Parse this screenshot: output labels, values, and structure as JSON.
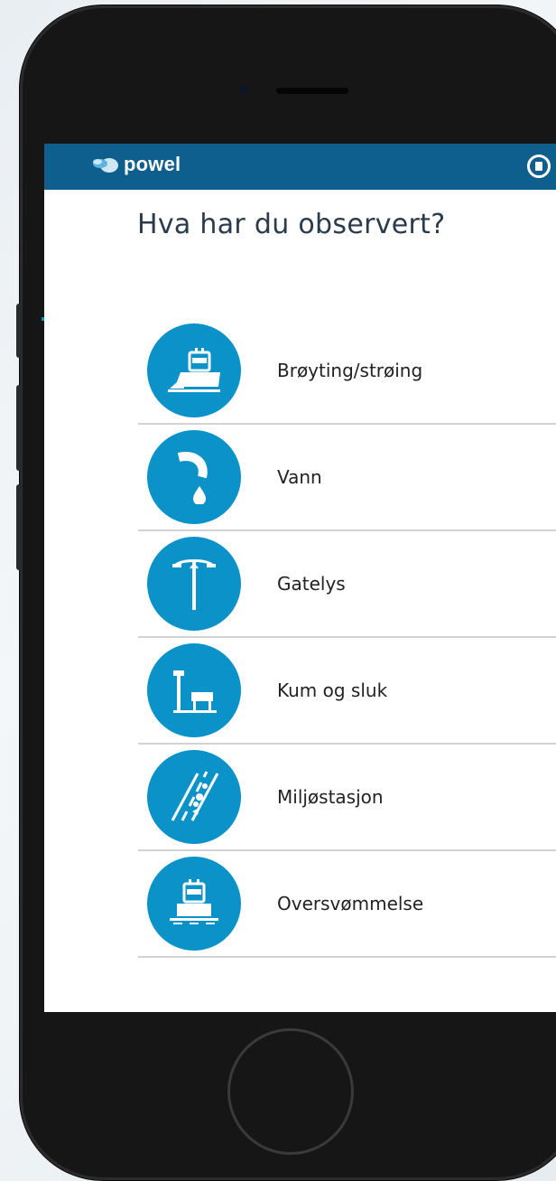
{
  "app": {
    "logo_text": "powel",
    "menu_icon": "menu-icon"
  },
  "page": {
    "title": "Hva har du observert?"
  },
  "categories": [
    {
      "label": "Brøyting/strøing",
      "icon": "snowplow-icon"
    },
    {
      "label": "Vann",
      "icon": "water-tap-icon"
    },
    {
      "label": "Gatelys",
      "icon": "streetlight-icon"
    },
    {
      "label": "Kum og sluk",
      "icon": "drain-icon"
    },
    {
      "label": "Miljøstasjon",
      "icon": "road-debris-icon"
    },
    {
      "label": "Oversvømmelse",
      "icon": "flood-icon"
    }
  ],
  "colors": {
    "topbar": "#0f5f8e",
    "accent": "#0a92c9",
    "title_text": "#2a3b4d"
  }
}
